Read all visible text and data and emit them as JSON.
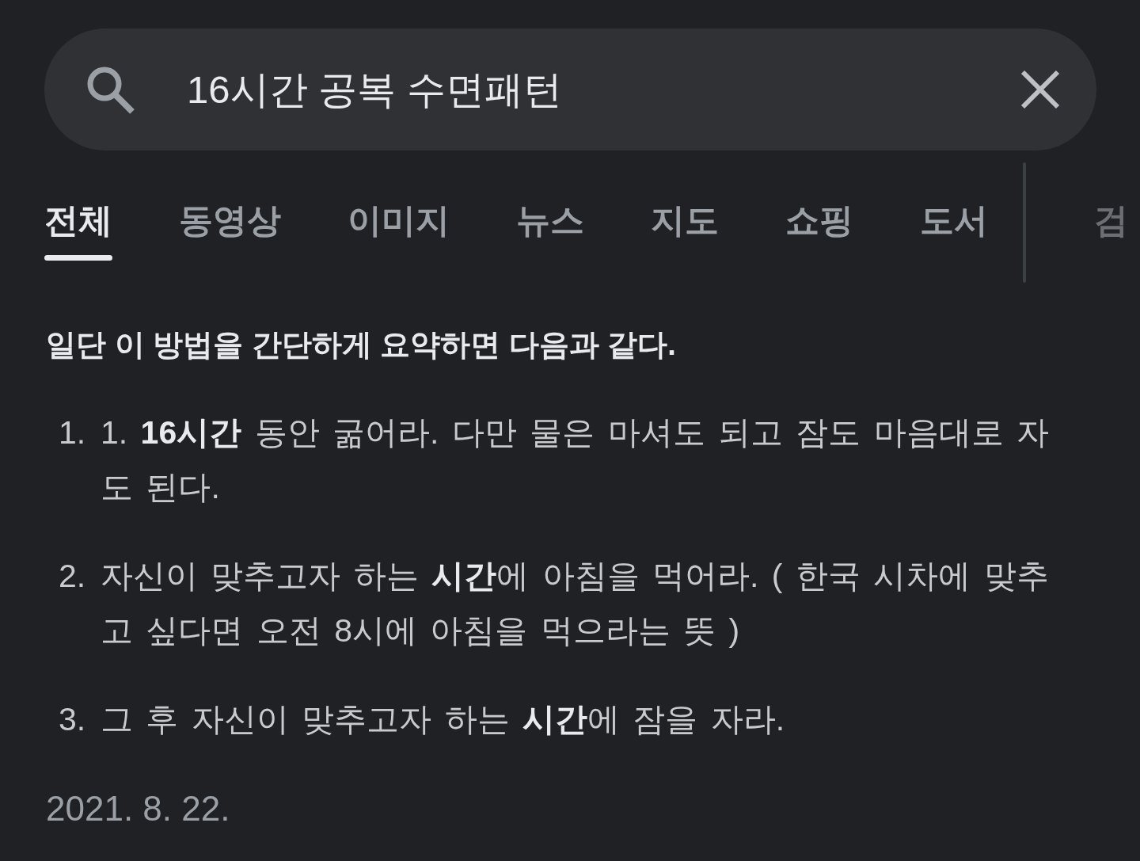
{
  "search": {
    "query": "16시간 공복 수면패턴"
  },
  "tabs": [
    {
      "label": "전체",
      "selected": true
    },
    {
      "label": "동영상",
      "selected": false
    },
    {
      "label": "이미지",
      "selected": false
    },
    {
      "label": "뉴스",
      "selected": false
    },
    {
      "label": "지도",
      "selected": false
    },
    {
      "label": "쇼핑",
      "selected": false
    },
    {
      "label": "도서",
      "selected": false
    }
  ],
  "tools_tab": {
    "label": "검"
  },
  "snippet": {
    "heading": "일단 이 방법을 간단하게 요약하면 다음과 같다.",
    "items": [
      {
        "number": "1.",
        "text": "1. **16시간** 동안 굶어라. 다만 물은 마셔도 되고 잠도 마음대로 자도 된다."
      },
      {
        "number": "2.",
        "text": "자신이 맞추고자 하는 **시간**에 아침을 먹어라. ( 한국 시차에 맞추고 싶다면 오전 8시에 아침을 먹으라는 뜻 )"
      },
      {
        "number": "3.",
        "text": "그 후 자신이 맞추고자 하는 **시간**에 잠을 자라."
      }
    ],
    "date": "2021. 8. 22."
  }
}
